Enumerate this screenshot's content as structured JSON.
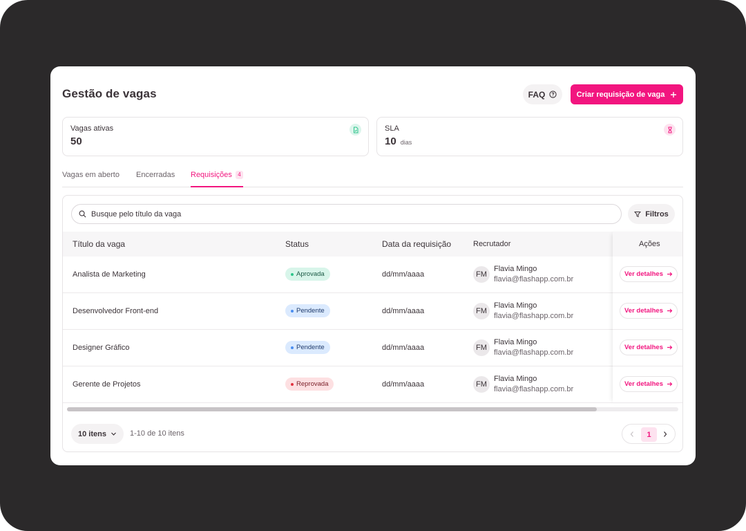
{
  "header": {
    "title": "Gestão de vagas",
    "faq_label": "FAQ",
    "create_label": "Criar requisição de vaga"
  },
  "stats": [
    {
      "label": "Vagas ativas",
      "value": "50",
      "unit": "",
      "icon": "document-check-icon",
      "icon_color": "#2bc48a"
    },
    {
      "label": "SLA",
      "value": "10",
      "unit": "dias",
      "icon": "hourglass-icon",
      "icon_color": "#f2157f"
    }
  ],
  "tabs": [
    {
      "label": "Vagas em aberto",
      "active": false
    },
    {
      "label": "Encerradas",
      "active": false
    },
    {
      "label": "Requisições",
      "count": "4",
      "active": true
    }
  ],
  "search": {
    "placeholder": "Busque pelo título da vaga"
  },
  "filters_label": "Filtros",
  "table": {
    "columns": [
      "Título da vaga",
      "Status",
      "Data da requisição",
      "Recrutador",
      "Ações"
    ],
    "rows": [
      {
        "title": "Analista de Marketing",
        "status": "Aprovada",
        "status_color": "green",
        "date": "dd/mm/aaaa",
        "initials": "FM",
        "recruiter": "Flavia Mingo",
        "email": "flavia@flashapp.com.br",
        "action": "Ver detalhes"
      },
      {
        "title": "Desenvolvedor Front-end",
        "status": "Pendente",
        "status_color": "blue",
        "date": "dd/mm/aaaa",
        "initials": "FM",
        "recruiter": "Flavia Mingo",
        "email": "flavia@flashapp.com.br",
        "action": "Ver detalhes"
      },
      {
        "title": "Designer Gráfico",
        "status": "Pendente",
        "status_color": "blue",
        "date": "dd/mm/aaaa",
        "initials": "FM",
        "recruiter": "Flavia Mingo",
        "email": "flavia@flashapp.com.br",
        "action": "Ver detalhes"
      },
      {
        "title": "Gerente de Projetos",
        "status": "Reprovada",
        "status_color": "red",
        "date": "dd/mm/aaaa",
        "initials": "FM",
        "recruiter": "Flavia Mingo",
        "email": "flavia@flashapp.com.br",
        "action": "Ver detalhes"
      }
    ]
  },
  "pagination": {
    "page_size_label": "10 itens",
    "info": "1-10 de 10 itens",
    "current_page": "1"
  },
  "colors": {
    "accent": "#f2157f",
    "frame": "#2b292a"
  }
}
